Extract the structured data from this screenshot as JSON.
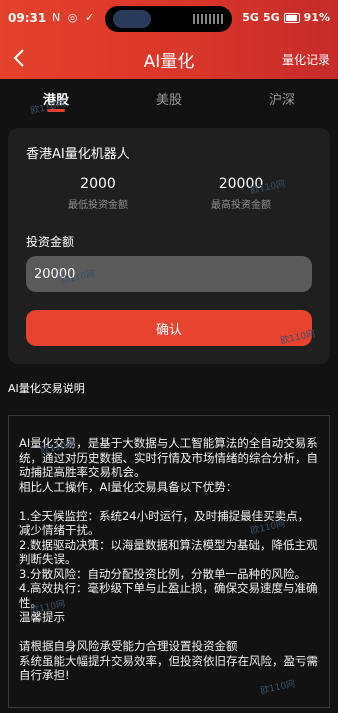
{
  "status": {
    "time": "09:31",
    "left_icons": "N ◎ ✓",
    "network": "5G",
    "network2": "5G",
    "battery": "91%"
  },
  "header": {
    "title": "AI量化",
    "right_link": "量化记录"
  },
  "tabs": [
    {
      "label": "港股",
      "active": true
    },
    {
      "label": "美股",
      "active": false
    },
    {
      "label": "沪深",
      "active": false
    }
  ],
  "card": {
    "title": "香港AI量化机器人",
    "min": {
      "value": "2000",
      "label": "最低投资金额"
    },
    "max": {
      "value": "20000",
      "label": "最高投资金额"
    },
    "amount_label": "投资金额",
    "amount_value": "20000",
    "confirm_label": "确认"
  },
  "description": {
    "heading": "AI量化交易说明",
    "lines": [
      "AI量化交易，是基于大数据与人工智能算法的全自动交易系统，通过对历史数据、实时行情及市场情绪的综合分析，自动捕捉高胜率交易机会。",
      "相比人工操作，AI量化交易具备以下优势：",
      "",
      "1.全天候监控：系统24小时运行，及时捕捉最佳买卖点，减少情绪干扰。",
      "2.数据驱动决策：以海量数据和算法模型为基础，降低主观判断失误。",
      "3.分散风险：自动分配投资比例，分散单一品种的风险。",
      "4.高效执行：毫秒级下单与止盈止损，确保交易速度与准确性。",
      "温馨提示",
      "",
      "请根据自身风险承受能力合理设置投资金额",
      "系统虽能大幅提升交易效率，但投资依旧存在风险，盈亏需自行承担!"
    ]
  },
  "watermark_text": "欧110网"
}
